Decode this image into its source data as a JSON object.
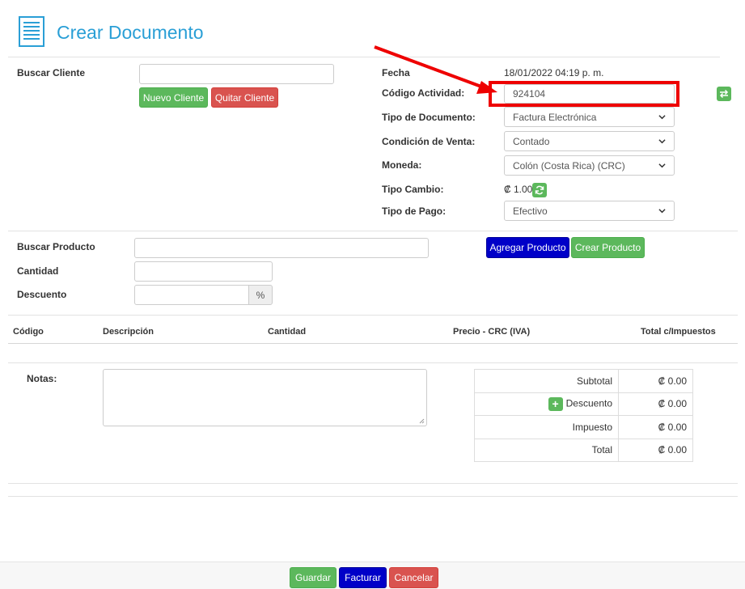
{
  "header": {
    "title": "Crear Documento",
    "icon": "document-list-icon"
  },
  "client": {
    "search_label": "Buscar Cliente",
    "search_value": "",
    "new_client_label": "Nuevo Cliente",
    "remove_client_label": "Quitar Cliente"
  },
  "document": {
    "fecha_label": "Fecha",
    "fecha_value": "18/01/2022 04:19 p. m.",
    "actividad_label": "Código Actividad:",
    "actividad_value": "924104",
    "tipo_doc_label": "Tipo de Documento:",
    "tipo_doc_value": "Factura Electrónica",
    "condicion_label": "Condición de Venta:",
    "condicion_value": "Contado",
    "moneda_label": "Moneda:",
    "moneda_value": "Colón (Costa Rica) (CRC)",
    "tipo_cambio_label": "Tipo Cambio:",
    "tipo_cambio_value": "₡ 1.00",
    "tipo_pago_label": "Tipo de Pago:",
    "tipo_pago_value": "Efectivo"
  },
  "product": {
    "search_label": "Buscar Producto",
    "cantidad_label": "Cantidad",
    "descuento_label": "Descuento",
    "descuento_addon": "%",
    "add_label": "Agregar Producto",
    "create_label": "Crear Producto"
  },
  "table": {
    "headers": [
      "Código",
      "Descripción",
      "Cantidad",
      "Precio - CRC (IVA)",
      "Total c/Impuestos"
    ]
  },
  "notes": {
    "label": "Notas:"
  },
  "totals": {
    "subtotal_label": "Subtotal",
    "subtotal_value": "₡ 0.00",
    "descuento_label": "Descuento",
    "descuento_value": "₡ 0.00",
    "impuesto_label": "Impuesto",
    "impuesto_value": "₡ 0.00",
    "total_label": "Total",
    "total_value": "₡ 0.00"
  },
  "footer": {
    "save_label": "Guardar",
    "invoice_label": "Facturar",
    "cancel_label": "Cancelar"
  },
  "colors": {
    "title": "#2a9fd6",
    "green": "#5cb85c",
    "red": "#d9534f",
    "blue": "#0000c8",
    "highlight": "#ee0000"
  }
}
